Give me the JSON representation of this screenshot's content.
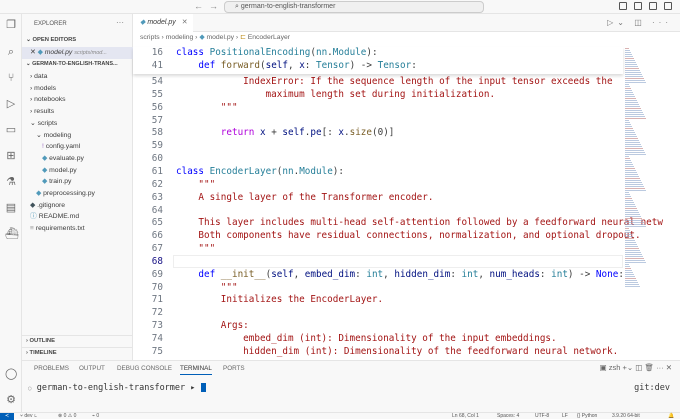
{
  "titlebar": {
    "search": "german-to-english-transformer",
    "back": "←",
    "forward": "→"
  },
  "activity": [
    "files-icon",
    "search-icon",
    "source-control-icon",
    "run-debug-icon",
    "remote-explorer-icon",
    "extensions-icon",
    "testing-icon",
    "folder-icon",
    "docker-icon",
    "account-icon",
    "settings-icon"
  ],
  "sidebar": {
    "title": "EXPLORER",
    "more": "···",
    "open_editors": "OPEN EDITORS",
    "open_file": "model.py",
    "open_file_path": "scripts/mod...",
    "project": "GERMAN-TO-ENGLISH-TRANS...",
    "tree": [
      {
        "label": "data",
        "indent": 1,
        "type": "folder",
        "open": false
      },
      {
        "label": "models",
        "indent": 1,
        "type": "folder",
        "open": false
      },
      {
        "label": "notebooks",
        "indent": 1,
        "type": "folder",
        "open": false
      },
      {
        "label": "results",
        "indent": 1,
        "type": "folder",
        "open": false
      },
      {
        "label": "scripts",
        "indent": 1,
        "type": "folder",
        "open": true
      },
      {
        "label": "modeling",
        "indent": 2,
        "type": "folder",
        "open": true
      },
      {
        "label": "config.yaml",
        "indent": 3,
        "type": "yaml"
      },
      {
        "label": "evaluate.py",
        "indent": 3,
        "type": "py"
      },
      {
        "label": "model.py",
        "indent": 3,
        "type": "py"
      },
      {
        "label": "train.py",
        "indent": 3,
        "type": "py"
      },
      {
        "label": "preprocessing.py",
        "indent": 2,
        "type": "py"
      },
      {
        "label": ".gitignore",
        "indent": 1,
        "type": "git"
      },
      {
        "label": "README.md",
        "indent": 1,
        "type": "info"
      },
      {
        "label": "requirements.txt",
        "indent": 1,
        "type": "txt"
      }
    ],
    "outline": "OUTLINE",
    "timeline": "TIMELINE"
  },
  "editor": {
    "tab": "model.py",
    "breadcrumbs": [
      "scripts",
      "modeling",
      "model.py",
      "EncoderLayer"
    ],
    "sticky": [
      {
        "n": "16",
        "html": "<span class='kw'>class</span> <span class='cls'>PositionalEncoding</span>(<span class='cls'>nn</span>.<span class='cls'>Module</span>):"
      },
      {
        "n": "41",
        "html": "    <span class='kw'>def</span> <span class='fn'>forward</span>(<span class='prm'>self</span>, <span class='prm'>x</span>: <span class='cls'>Tensor</span>) -> <span class='cls'>Tensor</span>:"
      }
    ],
    "lines": [
      {
        "n": "54",
        "html": "<span class='str'>            IndexError: If the sequence length of the input tensor exceeds the</span>"
      },
      {
        "n": "55",
        "html": "<span class='str'>                maximum length set during initialization.</span>"
      },
      {
        "n": "56",
        "html": "<span class='str'>        \"\"\"</span>"
      },
      {
        "n": "57",
        "html": ""
      },
      {
        "n": "58",
        "html": "        <span class='ctl'>return</span> <span class='prm'>x</span> + <span class='prm'>self</span>.<span class='prm'>pe</span>[: <span class='prm'>x</span>.<span class='fn'>size</span>(0)]"
      },
      {
        "n": "59",
        "html": ""
      },
      {
        "n": "60",
        "html": ""
      },
      {
        "n": "61",
        "html": "<span class='kw'>class</span> <span class='cls'>EncoderLayer</span>(<span class='cls'>nn</span>.<span class='cls'>Module</span>):"
      },
      {
        "n": "62",
        "html": "<span class='str'>    \"\"\"</span>"
      },
      {
        "n": "63",
        "html": "<span class='str'>    A single layer of the Transformer encoder.</span>"
      },
      {
        "n": "64",
        "html": ""
      },
      {
        "n": "65",
        "html": "<span class='str'>    This layer includes multi-head self-attention followed by a feedforward neural netw</span>"
      },
      {
        "n": "66",
        "html": "<span class='str'>    Both components have residual connections, normalization, and optional dropout.</span>"
      },
      {
        "n": "67",
        "html": "<span class='str'>    \"\"\"</span>"
      },
      {
        "n": "68",
        "html": ""
      },
      {
        "n": "69",
        "html": "    <span class='kw'>def</span> <span class='fn'>__init__</span>(<span class='prm'>self</span>, <span class='prm'>embed_dim</span>: <span class='cls'>int</span>, <span class='prm'>hidden_dim</span>: <span class='cls'>int</span>, <span class='prm'>num_heads</span>: <span class='cls'>int</span>) -> <span class='kw'>None</span>:"
      },
      {
        "n": "70",
        "html": "<span class='str'>        \"\"\"</span>"
      },
      {
        "n": "71",
        "html": "<span class='str'>        Initializes the EncoderLayer.</span>"
      },
      {
        "n": "72",
        "html": ""
      },
      {
        "n": "73",
        "html": "<span class='str'>        Args:</span>"
      },
      {
        "n": "74",
        "html": "<span class='str'>            embed_dim (int): Dimensionality of the input embeddings.</span>"
      },
      {
        "n": "75",
        "html": "<span class='str'>            hidden_dim (int): Dimensionality of the feedforward neural network.</span>"
      }
    ]
  },
  "panel": {
    "tabs": [
      "PROBLEMS",
      "OUTPUT",
      "DEBUG CONSOLE",
      "TERMINAL",
      "PORTS"
    ],
    "active": "TERMINAL",
    "shell": "zsh",
    "prompt": "german-to-english-transformer",
    "arrow": "▸",
    "git": "git:dev"
  },
  "status": {
    "branch": "dev",
    "problems": "⊗ 0  ⚠ 0",
    "ports": "0",
    "position": "Ln 68, Col 1",
    "spaces": "Spaces: 4",
    "encoding": "UTF-8",
    "eol": "LF",
    "language": "{} Python",
    "interpreter": "3.9.20 64-bit"
  }
}
